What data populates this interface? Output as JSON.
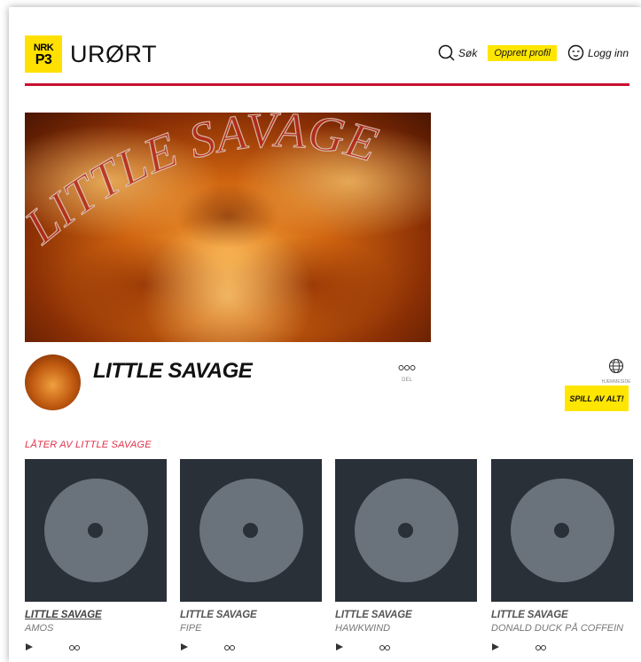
{
  "header": {
    "logo_line1": "NRK",
    "logo_line2": "P3",
    "site_title": "URØRT",
    "search_label": "Søk",
    "create_profile_label": "Opprett profil",
    "login_label": "Logg inn",
    "accent_color": "#c8102e",
    "brand_yellow": "#ffe600"
  },
  "hero": {
    "banner_text": "LITTLE SAVAGE"
  },
  "artist": {
    "name": "LITTLE SAVAGE",
    "share_label": "DEL",
    "homepage_label": "HJEMMESIDE",
    "play_all_label": "SPILL AV ALT!"
  },
  "tracks_section": {
    "title": "LÅTER AV LITTLE SAVAGE",
    "tracks": [
      {
        "artist": "LITTLE SAVAGE",
        "title": "AMOS"
      },
      {
        "artist": "LITTLE SAVAGE",
        "title": "FIPE"
      },
      {
        "artist": "LITTLE SAVAGE",
        "title": "HAWKWIND"
      },
      {
        "artist": "LITTLE SAVAGE",
        "title": "DONALD DUCK PÅ COFFEIN"
      }
    ]
  }
}
